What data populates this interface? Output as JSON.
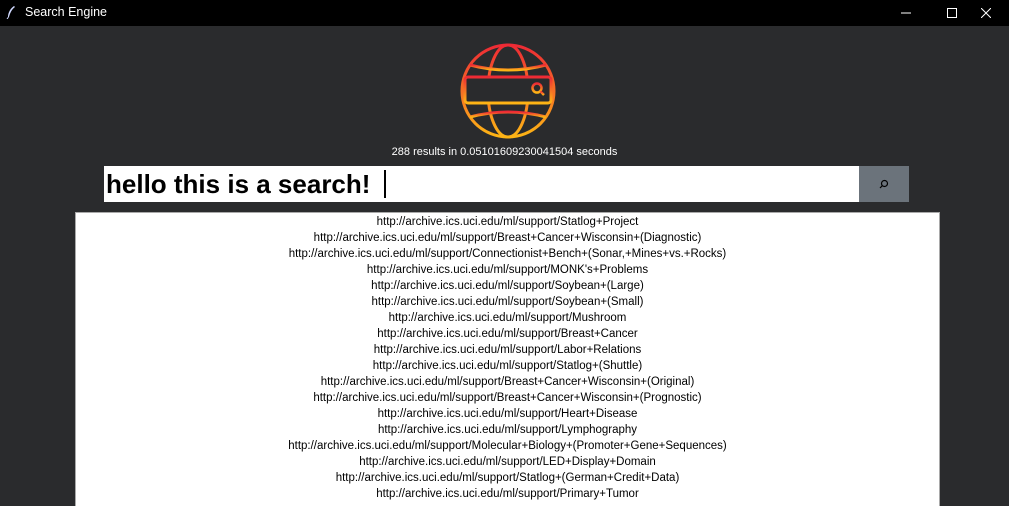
{
  "window": {
    "title": "Search Engine",
    "icon": "feather-icon"
  },
  "status": {
    "text": "288 results in 0.05101609230041504 seconds"
  },
  "search": {
    "value": "hello this is a search!",
    "button_icon": "search-icon"
  },
  "results": [
    "http://archive.ics.uci.edu/ml/support/Statlog+Project",
    "http://archive.ics.uci.edu/ml/support/Breast+Cancer+Wisconsin+(Diagnostic)",
    "http://archive.ics.uci.edu/ml/support/Connectionist+Bench+(Sonar,+Mines+vs.+Rocks)",
    "http://archive.ics.uci.edu/ml/support/MONK's+Problems",
    "http://archive.ics.uci.edu/ml/support/Soybean+(Large)",
    "http://archive.ics.uci.edu/ml/support/Soybean+(Small)",
    "http://archive.ics.uci.edu/ml/support/Mushroom",
    "http://archive.ics.uci.edu/ml/support/Breast+Cancer",
    "http://archive.ics.uci.edu/ml/support/Labor+Relations",
    "http://archive.ics.uci.edu/ml/support/Statlog+(Shuttle)",
    "http://archive.ics.uci.edu/ml/support/Breast+Cancer+Wisconsin+(Original)",
    "http://archive.ics.uci.edu/ml/support/Breast+Cancer+Wisconsin+(Prognostic)",
    "http://archive.ics.uci.edu/ml/support/Heart+Disease",
    "http://archive.ics.uci.edu/ml/support/Lymphography",
    "http://archive.ics.uci.edu/ml/support/Molecular+Biology+(Promoter+Gene+Sequences)",
    "http://archive.ics.uci.edu/ml/support/LED+Display+Domain",
    "http://archive.ics.uci.edu/ml/support/Statlog+(German+Credit+Data)",
    "http://archive.ics.uci.edu/ml/support/Primary+Tumor"
  ],
  "colors": {
    "background": "#2a2b2d",
    "titlebar": "#000000",
    "search_button": "#6b737b",
    "logo_gradient_top": "#ee2a35",
    "logo_gradient_bottom": "#fdb515"
  }
}
